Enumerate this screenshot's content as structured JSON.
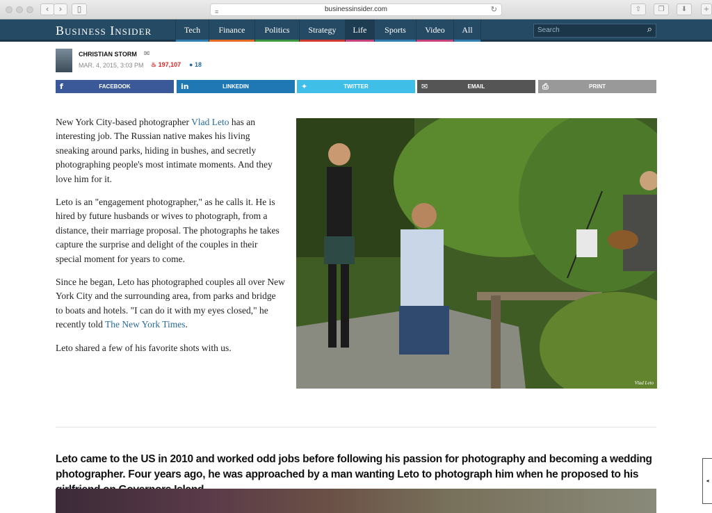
{
  "browser": {
    "url": "businessinsider.com",
    "back_icon": "chevron-left-icon",
    "forward_icon": "chevron-right-icon"
  },
  "site": {
    "logo": "Business Insider",
    "nav": [
      {
        "label": "Tech",
        "color": "#2f7fb5"
      },
      {
        "label": "Finance",
        "color": "#e46b1f"
      },
      {
        "label": "Politics",
        "color": "#3b9a3b"
      },
      {
        "label": "Strategy",
        "color": "#d03a2a"
      },
      {
        "label": "Life",
        "color": "#c8437a"
      },
      {
        "label": "Sports",
        "color": "#2f7fb5"
      },
      {
        "label": "Video",
        "color": "#c8437a"
      },
      {
        "label": "All",
        "color": "#2f7fb5"
      }
    ],
    "active_nav": "Life",
    "search_placeholder": "Search"
  },
  "byline": {
    "author": "CHRISTIAN STORM",
    "date": "MAR. 4, 2015, 3:03 PM",
    "views": "197,107",
    "comments": "18"
  },
  "share": [
    {
      "label": "FACEBOOK",
      "icon": "facebook-icon",
      "glyph": "f",
      "color": "#3b5998"
    },
    {
      "label": "LINKEDIN",
      "icon": "linkedin-icon",
      "glyph": "in",
      "color": "#1f78b4"
    },
    {
      "label": "TWITTER",
      "icon": "twitter-icon",
      "glyph": "✦",
      "color": "#3fbfe8"
    },
    {
      "label": "EMAIL",
      "icon": "email-icon",
      "glyph": "✉",
      "color": "#555555"
    },
    {
      "label": "PRINT",
      "icon": "print-icon",
      "glyph": "⎙",
      "color": "#999999"
    }
  ],
  "article": {
    "p1_a": "New York City-based photographer ",
    "p1_link": "Vlad Leto",
    "p1_b": " has an interesting job. The Russian native makes his living sneaking around parks, hiding in bushes, and secretly photographing people's most intimate moments. And they love him for it.",
    "p2": "Leto is an \"engagement photographer,\" as he calls it. He is hired by future husbands or wives to photograph, from a distance, their marriage proposal. The photographs he takes capture the surprise and delight of the couples in their special moment for years to come.",
    "p3_a": "Since he began, Leto has photographed couples all over New York City and the surrounding area, from parks and bridge to boats and hotels. \"I can do it with my eyes closed,\" he recently told ",
    "p3_link": "The New York Times",
    "p3_b": ".",
    "p4": "Leto shared a few of his favorite shots with us.",
    "photo_credit": "Vlad Leto",
    "caption": "Leto came to the US in 2010 and worked odd jobs before following his passion for photography and becoming a wedding photographer. Four years ago, he was approached by a man wanting Leto to photograph him when he proposed to his girlfriend on Governors Island."
  }
}
